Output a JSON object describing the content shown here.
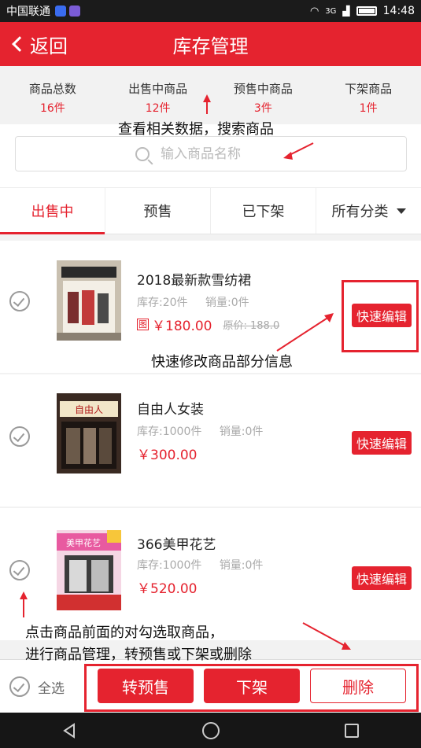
{
  "status_bar": {
    "carrier": "中国联通",
    "network": "3G",
    "time": "14:48"
  },
  "nav": {
    "back_label": "返回",
    "title": "库存管理"
  },
  "stats": [
    {
      "label": "商品总数",
      "count": "16件"
    },
    {
      "label": "出售中商品",
      "count": "12件"
    },
    {
      "label": "预售中商品",
      "count": "3件"
    },
    {
      "label": "下架商品",
      "count": "1件"
    }
  ],
  "search": {
    "placeholder": "输入商品名称"
  },
  "tabs": [
    {
      "label": "出售中",
      "active": true
    },
    {
      "label": "预售"
    },
    {
      "label": "已下架"
    },
    {
      "label": "所有分类"
    }
  ],
  "items": [
    {
      "name": "2018最新款雪纺裙",
      "stock": "库存:20件",
      "sales": "销量:0件",
      "badge": "图",
      "price": "￥180.00",
      "original_price": "原价: 188.0",
      "quick_edit": "快速编辑"
    },
    {
      "name": "自由人女装",
      "stock": "库存:1000件",
      "sales": "销量:0件",
      "price": "￥300.00",
      "quick_edit": "快速编辑"
    },
    {
      "name": "366美甲花艺",
      "stock": "库存:1000件",
      "sales": "销量:0件",
      "price": "￥520.00",
      "quick_edit": "快速编辑"
    }
  ],
  "bottom": {
    "select_all": "全选",
    "to_presale": "转预售",
    "off_shelf": "下架",
    "delete": "删除"
  },
  "annotations": {
    "stats_hint": "查看相关数据，搜索商品",
    "quick_edit_hint": "快速修改商品部分信息",
    "select_hint_1": "点击商品前面的对勾选取商品，",
    "select_hint_2": "进行商品管理，转预售或下架或删除"
  },
  "colors": {
    "brand_red": "#e5232f"
  }
}
